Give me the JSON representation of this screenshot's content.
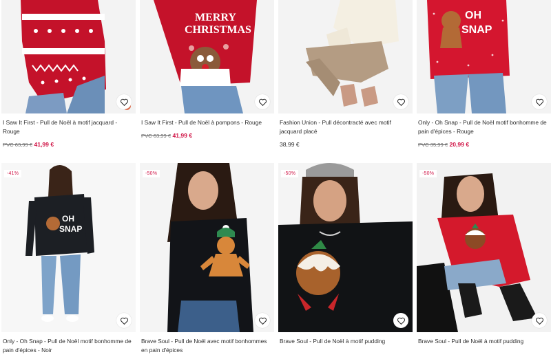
{
  "colors": {
    "sale": "#d01345",
    "text": "#2d2d2d"
  },
  "products": [
    {
      "title": "I Saw It First - Pull de Noël à motif jacquard - Rouge",
      "rrp": "PVC 63,99 €",
      "price": "41,99 €",
      "badge": "",
      "photo": "red-nordic-jacquard-sweater"
    },
    {
      "title": "I Saw It First - Pull de Noël à pompons - Rouge",
      "rrp": "PVC 63,99 €",
      "price": "41,99 €",
      "badge": "",
      "photo": "red-merry-christmas-reindeer-sweater"
    },
    {
      "title": "Fashion Union - Pull décontracté avec motif jacquard placé",
      "rrp": "",
      "price": "38,99 €",
      "badge": "",
      "photo": "cream-sweater-beige-trousers"
    },
    {
      "title": "Only - Oh Snap - Pull de Noël motif bonhomme de pain d'épices - Rouge",
      "rrp": "PVC 35,99 €",
      "price": "20,99 €",
      "badge": "",
      "photo": "red-oh-snap-gingerbread-sweater"
    },
    {
      "title": "Only - Oh Snap - Pull de Noël motif bonhomme de pain d'épices - Noir",
      "rrp": "",
      "price": "",
      "badge": "-41%",
      "photo": "black-oh-snap-gingerbread-sweater"
    },
    {
      "title": "Brave Soul - Pull de Noël avec motif bonhommes en pain d'épices",
      "rrp": "",
      "price": "",
      "badge": "-50%",
      "photo": "black-gingerbread-man-sweater"
    },
    {
      "title": "Brave Soul - Pull de Noël à motif pudding",
      "rrp": "",
      "price": "",
      "badge": "-50%",
      "photo": "black-christmas-pudding-sweater"
    },
    {
      "title": "Brave Soul - Pull de Noël à motif pudding",
      "rrp": "",
      "price": "",
      "badge": "-50%",
      "photo": "red-christmas-pudding-sweater"
    }
  ]
}
